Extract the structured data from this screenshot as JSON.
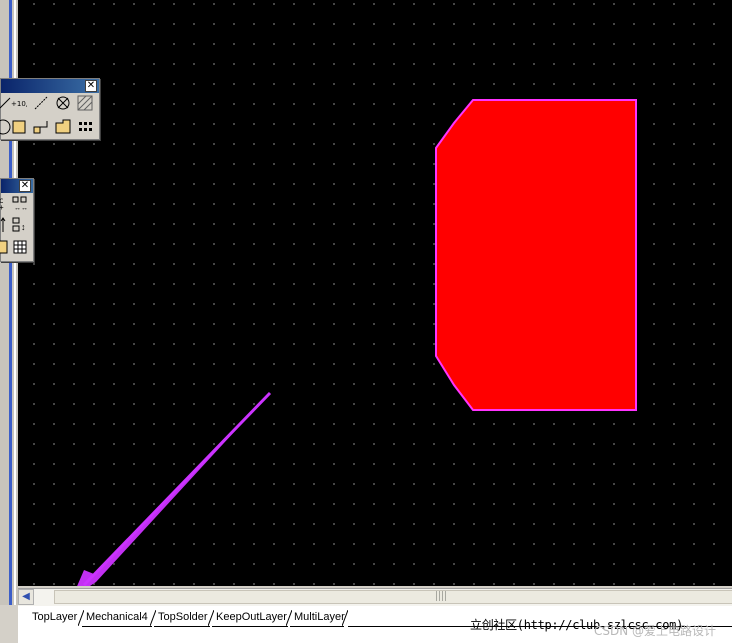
{
  "layer_tabs": [
    "TopLayer",
    "Mechanical4",
    "TopSolder",
    "KeepOutLayer",
    "MultiLayer"
  ],
  "active_tab": "TopLayer",
  "status_site": "立创社区(http://club.szlcsc.com)",
  "watermark": "CSDN @爱上电路设计",
  "toolbar_close": "✕",
  "colors": {
    "canvas": "#000000",
    "pad_fill": "#ff0000",
    "pad_outline": "#ff33ff",
    "arrow": "#cc33ff"
  },
  "icons": {
    "placement_toolbar": [
      "line-icon",
      "coordinate-icon",
      "dimension-icon",
      "keepout-icon",
      "hatch-icon",
      "arc-icon",
      "fill-icon",
      "step-icon",
      "polygon-icon",
      "array-icon"
    ],
    "align_toolbar": [
      "align-left-icon",
      "distribute-icon",
      "align-top-icon",
      "distribute-vertical-icon",
      "group-icon",
      "grid-icon"
    ]
  }
}
